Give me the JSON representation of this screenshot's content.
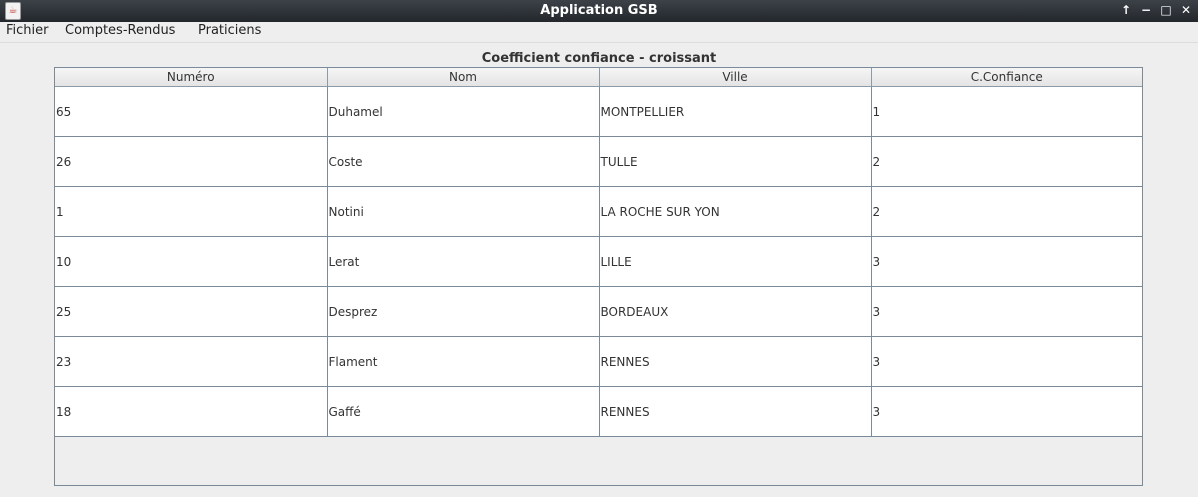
{
  "window": {
    "title": "Application GSB",
    "icon": "java-cup-icon",
    "controls": [
      "↑",
      "−",
      "□",
      "✕"
    ]
  },
  "menu": [
    "Fichier",
    "Comptes-Rendus",
    "Praticiens"
  ],
  "heading": "Coefficient confiance - croissant",
  "table": {
    "columns": [
      "Numéro",
      "Nom",
      "Ville",
      "C.Confiance"
    ],
    "rows": [
      [
        "65",
        "Duhamel",
        "MONTPELLIER",
        "1"
      ],
      [
        "26",
        "Coste",
        "TULLE",
        "2"
      ],
      [
        "1",
        "Notini",
        "LA ROCHE SUR YON",
        "2"
      ],
      [
        "10",
        "Lerat",
        "LILLE",
        "3"
      ],
      [
        "25",
        "Desprez",
        "BORDEAUX",
        "3"
      ],
      [
        "23",
        "Flament",
        "RENNES",
        "3"
      ],
      [
        "18",
        "Gaffé",
        "RENNES",
        "3"
      ]
    ]
  }
}
